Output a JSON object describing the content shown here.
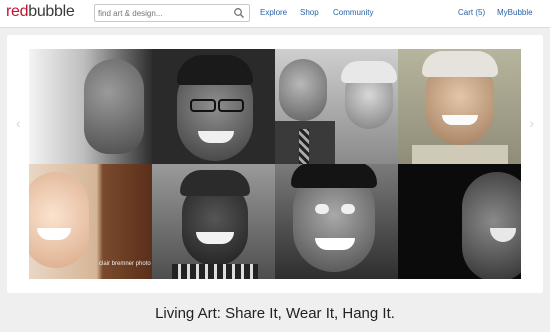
{
  "brand": {
    "part1": "red",
    "part2": "bubble"
  },
  "search": {
    "placeholder": "find art & design..."
  },
  "nav": {
    "explore": "Explore",
    "shop": "Shop",
    "community": "Community",
    "cart": "Cart (5)",
    "account": "MyBubble"
  },
  "mosaic": {
    "credit": "clair bremner photo"
  },
  "tagline": "Living Art: Share It, Wear It, Hang It.",
  "colors": {
    "brand_red": "#c4122f",
    "link_blue": "#2a62a6"
  },
  "icons": [
    "search-icon",
    "arrow-left-icon",
    "arrow-right-icon"
  ]
}
